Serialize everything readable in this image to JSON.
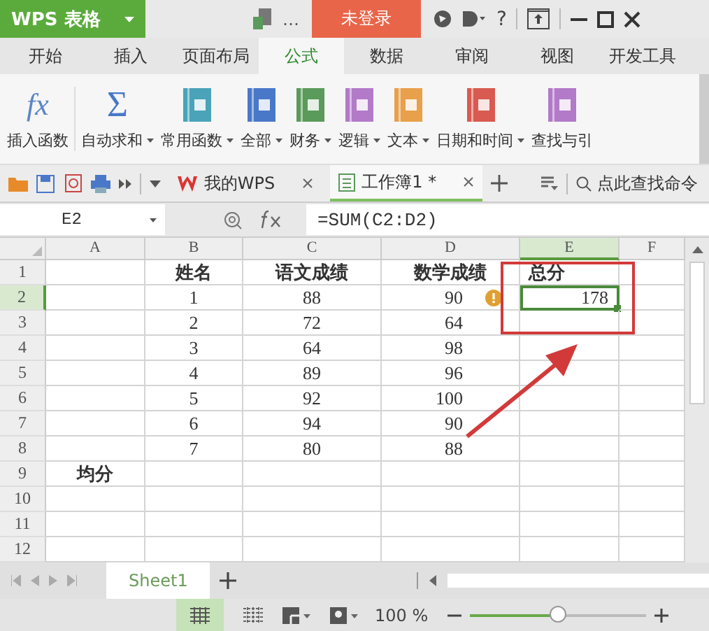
{
  "title_bar": {
    "app_name": "WPS 表格",
    "more": "…",
    "login": "未登录",
    "help": "?"
  },
  "ribbon_tabs": [
    {
      "label": "开始",
      "selected": false
    },
    {
      "label": "插入",
      "selected": false
    },
    {
      "label": "页面布局",
      "selected": false
    },
    {
      "label": "公式",
      "selected": true
    },
    {
      "label": "数据",
      "selected": false
    },
    {
      "label": "审阅",
      "selected": false
    },
    {
      "label": "视图",
      "selected": false
    },
    {
      "label": "开发工具",
      "selected": false
    }
  ],
  "ribbon_buttons": [
    {
      "label": "插入函数",
      "kind": "glyph",
      "glyph": "fx",
      "dropdown": false
    },
    {
      "label": "自动求和",
      "kind": "sigma",
      "glyph": "Σ",
      "dropdown": true
    },
    {
      "label": "常用函数",
      "kind": "book",
      "color": "#4aa3b8",
      "dropdown": true
    },
    {
      "label": "全部",
      "kind": "book",
      "color": "#4a78c8",
      "dropdown": true
    },
    {
      "label": "财务",
      "kind": "book",
      "color": "#5a9a5a",
      "dropdown": true
    },
    {
      "label": "逻辑",
      "kind": "book",
      "color": "#b27ac8",
      "dropdown": true
    },
    {
      "label": "文本",
      "kind": "book",
      "color": "#e8a04a",
      "dropdown": true
    },
    {
      "label": "日期和时间",
      "kind": "book",
      "color": "#d85a50",
      "dropdown": true
    },
    {
      "label": "查找与引",
      "kind": "book",
      "color": "#b27ac8",
      "dropdown": false
    }
  ],
  "doc_tabs": [
    {
      "label": "我的WPS",
      "selected": false
    },
    {
      "label": "工作簿1 *",
      "selected": true
    }
  ],
  "search": {
    "placeholder": "点此查找命令"
  },
  "formula_bar": {
    "name_box": "E2",
    "formula": "=SUM(C2:D2)"
  },
  "columns": [
    {
      "label": "A",
      "selected": false
    },
    {
      "label": "B",
      "selected": false
    },
    {
      "label": "C",
      "selected": false
    },
    {
      "label": "D",
      "selected": false
    },
    {
      "label": "E",
      "selected": true
    },
    {
      "label": "F",
      "selected": false
    }
  ],
  "rows": [
    {
      "label": "1",
      "selected": false,
      "cells": [
        {
          "text": ""
        },
        {
          "text": "姓名",
          "bold": true
        },
        {
          "text": "语文成绩",
          "bold": true
        },
        {
          "text": "数学成绩",
          "bold": true
        },
        {
          "text": "总分",
          "bold": true
        },
        {
          "text": ""
        }
      ]
    },
    {
      "label": "2",
      "selected": true,
      "cells": [
        {
          "text": ""
        },
        {
          "text": "1",
          "bold": false
        },
        {
          "text": "88",
          "bold": false
        },
        {
          "text": "90",
          "bold": false,
          "flag": true
        },
        {
          "text": "178",
          "bold": false
        },
        {
          "text": ""
        }
      ]
    },
    {
      "label": "3",
      "selected": false,
      "cells": [
        {
          "text": ""
        },
        {
          "text": "2",
          "bold": false
        },
        {
          "text": "72",
          "bold": false
        },
        {
          "text": "64",
          "bold": false
        },
        {
          "text": ""
        },
        {
          "text": ""
        }
      ]
    },
    {
      "label": "4",
      "selected": false,
      "cells": [
        {
          "text": ""
        },
        {
          "text": "3",
          "bold": false
        },
        {
          "text": "64",
          "bold": false
        },
        {
          "text": "98",
          "bold": false
        },
        {
          "text": ""
        },
        {
          "text": ""
        }
      ]
    },
    {
      "label": "5",
      "selected": false,
      "cells": [
        {
          "text": ""
        },
        {
          "text": "4",
          "bold": false
        },
        {
          "text": "89",
          "bold": false
        },
        {
          "text": "96",
          "bold": false
        },
        {
          "text": ""
        },
        {
          "text": ""
        }
      ]
    },
    {
      "label": "6",
      "selected": false,
      "cells": [
        {
          "text": ""
        },
        {
          "text": "5",
          "bold": false
        },
        {
          "text": "92",
          "bold": false
        },
        {
          "text": "100",
          "bold": false
        },
        {
          "text": ""
        },
        {
          "text": ""
        }
      ]
    },
    {
      "label": "7",
      "selected": false,
      "cells": [
        {
          "text": ""
        },
        {
          "text": "6",
          "bold": false
        },
        {
          "text": "94",
          "bold": false
        },
        {
          "text": "90",
          "bold": false
        },
        {
          "text": ""
        },
        {
          "text": ""
        }
      ]
    },
    {
      "label": "8",
      "selected": false,
      "cells": [
        {
          "text": ""
        },
        {
          "text": "7",
          "bold": false
        },
        {
          "text": "80",
          "bold": false
        },
        {
          "text": "88",
          "bold": false
        },
        {
          "text": ""
        },
        {
          "text": ""
        }
      ]
    },
    {
      "label": "9",
      "selected": false,
      "cells": [
        {
          "text": "均分",
          "bold": true
        },
        {
          "text": ""
        },
        {
          "text": ""
        },
        {
          "text": ""
        },
        {
          "text": ""
        },
        {
          "text": ""
        }
      ]
    },
    {
      "label": "10",
      "selected": false,
      "cells": [
        {
          "text": ""
        },
        {
          "text": ""
        },
        {
          "text": ""
        },
        {
          "text": ""
        },
        {
          "text": ""
        },
        {
          "text": ""
        }
      ]
    },
    {
      "label": "11",
      "selected": false,
      "cells": [
        {
          "text": ""
        },
        {
          "text": ""
        },
        {
          "text": ""
        },
        {
          "text": ""
        },
        {
          "text": ""
        },
        {
          "text": ""
        }
      ]
    },
    {
      "label": "12",
      "selected": false,
      "cells": [
        {
          "text": ""
        },
        {
          "text": ""
        },
        {
          "text": ""
        },
        {
          "text": ""
        },
        {
          "text": ""
        },
        {
          "text": ""
        }
      ]
    }
  ],
  "sheet_tabs": [
    {
      "label": "Sheet1",
      "selected": true
    }
  ],
  "status_bar": {
    "zoom": "100 %",
    "zoom_level": {
      "level": 0.5
    }
  }
}
